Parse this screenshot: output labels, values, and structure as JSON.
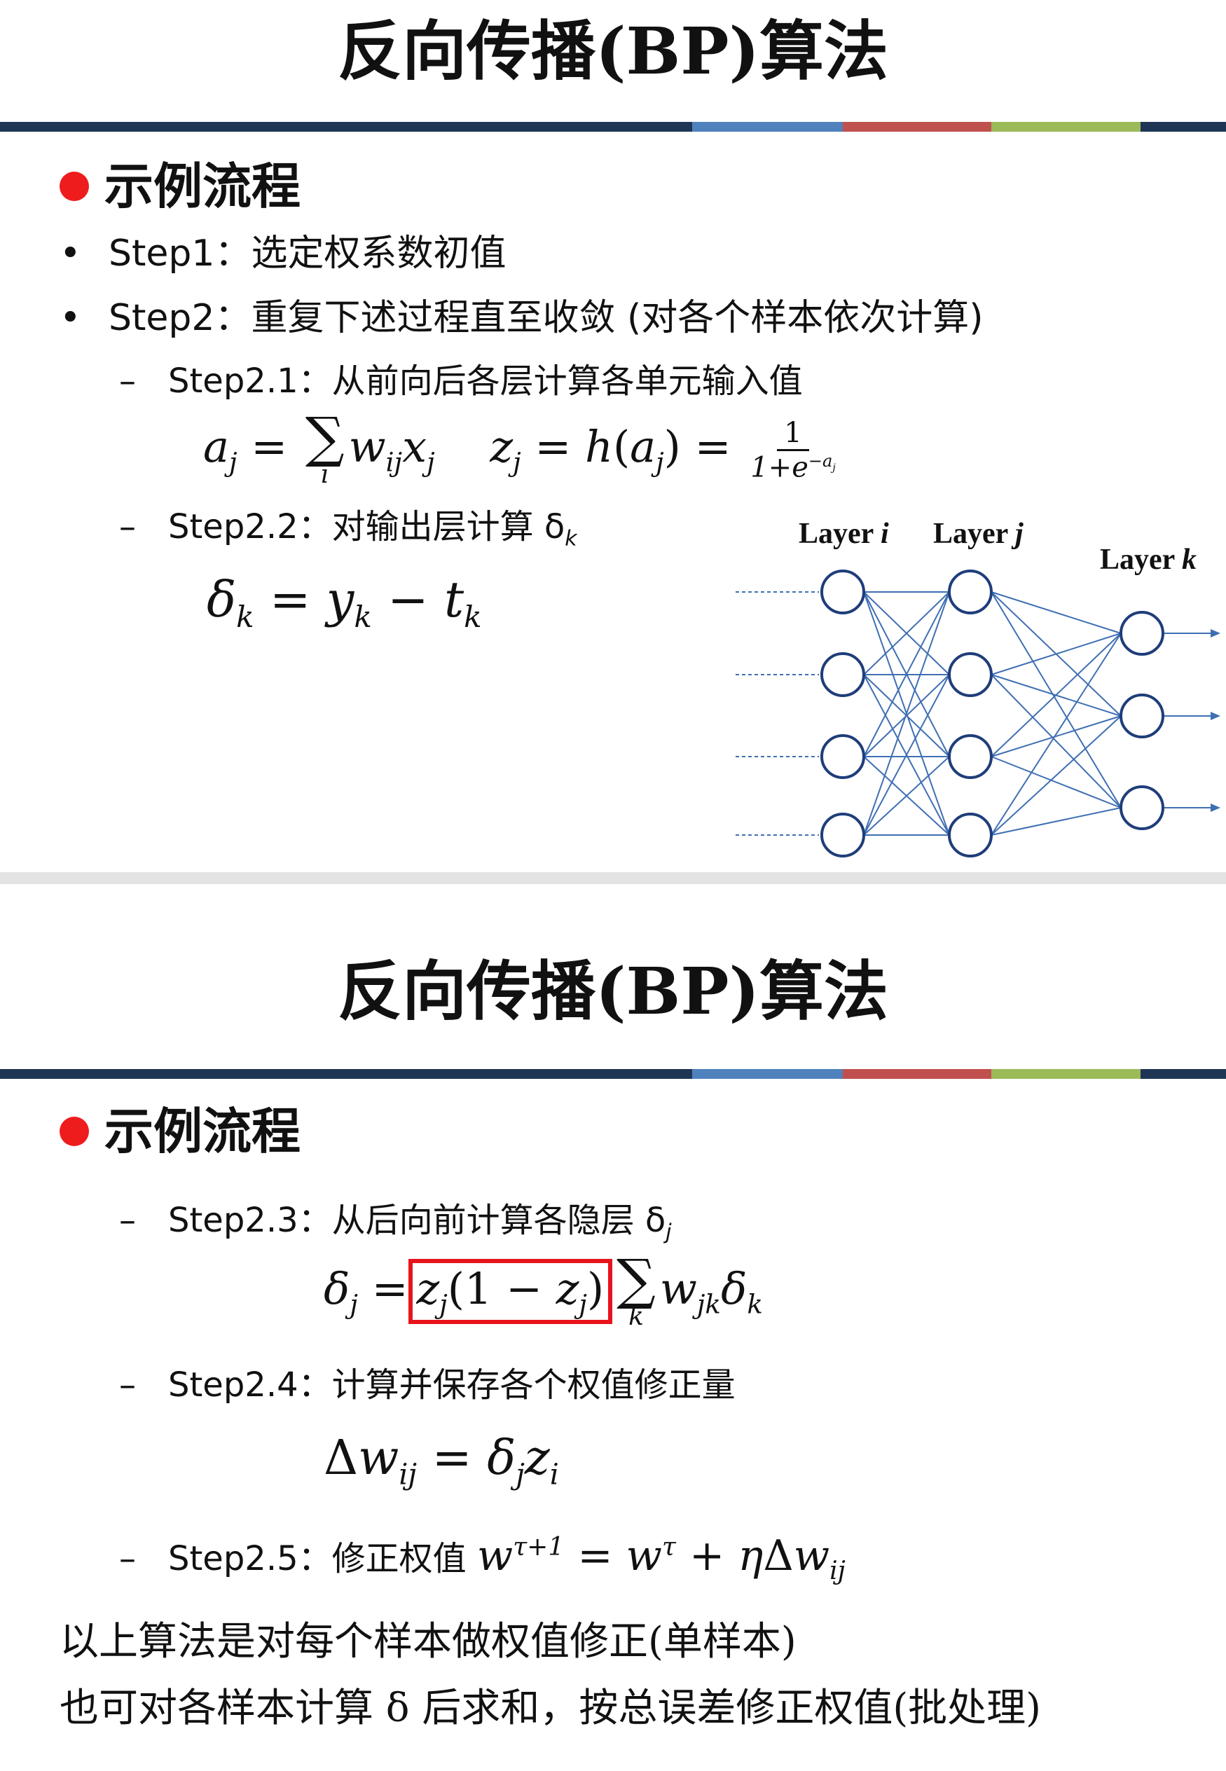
{
  "slide1": {
    "title": "反向传播(BP)算法",
    "heading": "示例流程",
    "bullet_marks": {
      "dot": "•",
      "dash": "–"
    },
    "step1": "Step1：选定权系数初值",
    "step2": "Step2：重复下述过程直至收敛 (对各个样本依次计算)",
    "step2_1": "Step2.1：从前向后各层计算各单元输入值",
    "step2_2": "Step2.2：对输出层计算 δ",
    "step2_2_sub": "k",
    "network": {
      "layer_i": "Layer",
      "layer_i_var": "i",
      "layer_j": "Layer",
      "layer_j_var": "j",
      "layer_k": "Layer",
      "layer_k_var": "k",
      "line_color": "#3f6fb3",
      "node_color": "#1f3d7a"
    }
  },
  "slide2": {
    "title": "反向传播(BP)算法",
    "heading": "示例流程",
    "step2_3": "Step2.3：从后向前计算各隐层 δ",
    "step2_3_sub": "j",
    "step2_4": "Step2.4：计算并保存各个权值修正量",
    "step2_5": "Step2.5：修正权值",
    "note1": "以上算法是对每个样本做权值修正(单样本)",
    "note2": "也可对各样本计算 δ 后求和，按总误差修正权值(批处理)"
  },
  "colors": {
    "bar_navy": "#1f3555",
    "bar_blue": "#4f81bd",
    "bar_red": "#c0504d",
    "bar_green": "#9bbb59",
    "bullet_red": "#ee1c1c",
    "highlight_box": "#e8141c"
  }
}
